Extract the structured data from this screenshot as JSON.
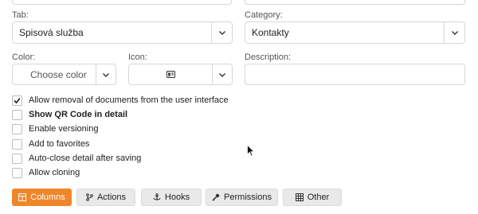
{
  "form": {
    "tab": {
      "label": "Tab:",
      "value": "Spisová služba"
    },
    "category": {
      "label": "Category:",
      "value": "Kontakty"
    },
    "color": {
      "label": "Color:",
      "value": "Choose color"
    },
    "icon": {
      "label": "Icon:",
      "value_icon": "address-card-icon"
    },
    "description": {
      "label": "Description:",
      "value": ""
    }
  },
  "options": [
    {
      "label": "Allow removal of documents from the user interface",
      "checked": true,
      "bold": false
    },
    {
      "label": "Show QR Code in detail",
      "checked": false,
      "bold": true
    },
    {
      "label": "Enable versioning",
      "checked": false,
      "bold": false
    },
    {
      "label": "Add to favorites",
      "checked": false,
      "bold": false
    },
    {
      "label": "Auto-close detail after saving",
      "checked": false,
      "bold": false
    },
    {
      "label": "Allow cloning",
      "checked": false,
      "bold": false
    }
  ],
  "tabs": [
    {
      "label": "Columns",
      "icon": "table-icon",
      "active": true
    },
    {
      "label": "Actions",
      "icon": "branch-icon",
      "active": false
    },
    {
      "label": "Hooks",
      "icon": "anchor-icon",
      "active": false
    },
    {
      "label": "Permissions",
      "icon": "key-icon",
      "active": false
    },
    {
      "label": "Other",
      "icon": "grid-icon",
      "active": false
    }
  ],
  "colors": {
    "accent": "#f0862a",
    "border": "#d7d7d7",
    "tab_bg": "#e9e9e9"
  }
}
